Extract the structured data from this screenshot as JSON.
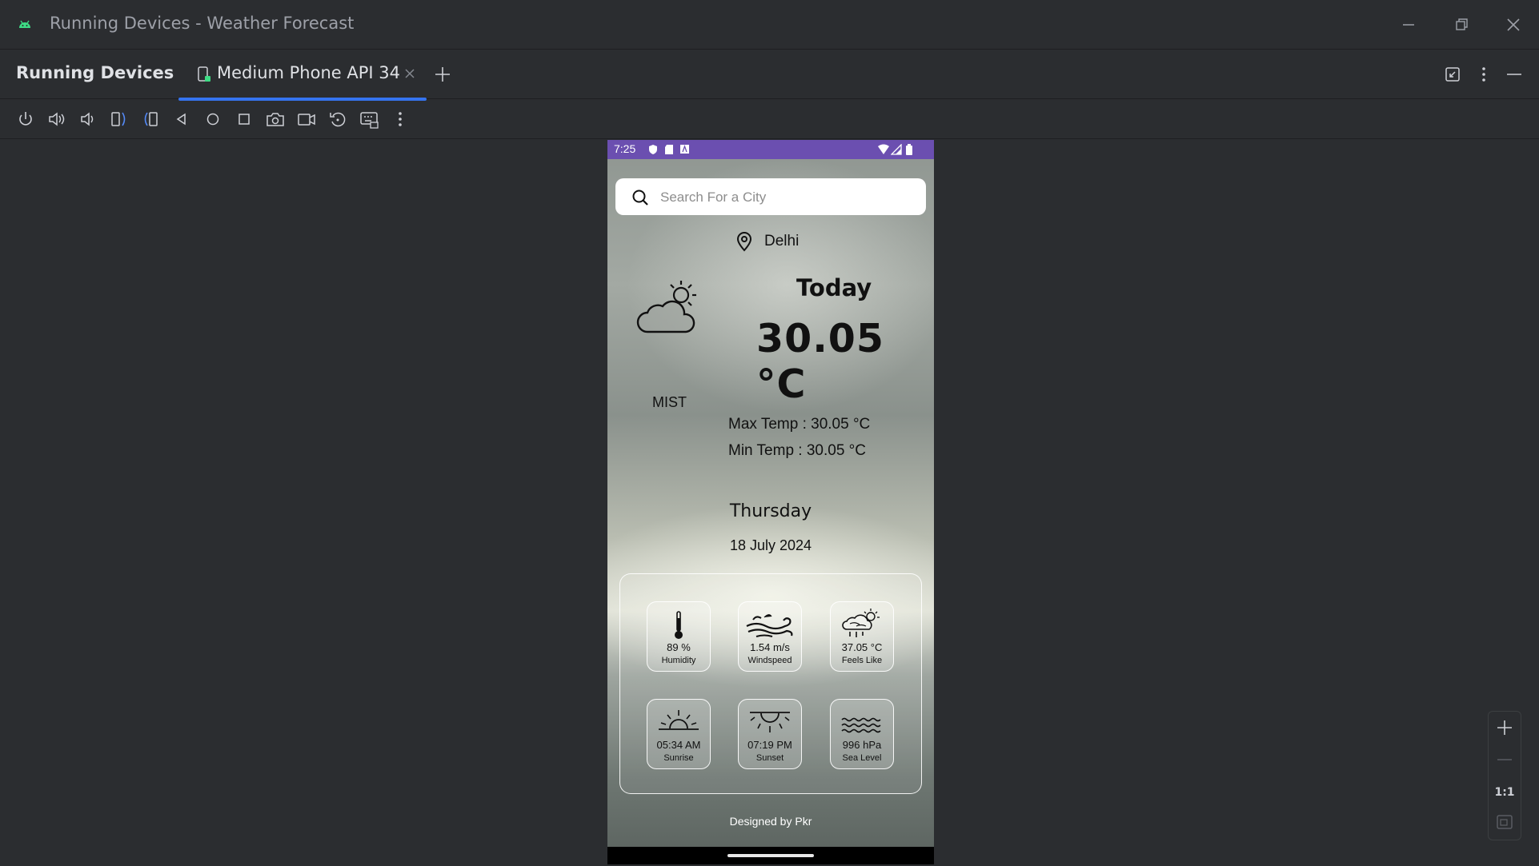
{
  "window": {
    "title": "Running Devices - Weather Forecast",
    "icons": [
      "android-icon",
      "minimize-icon",
      "restore-icon",
      "close-icon"
    ]
  },
  "panel": {
    "title": "Running Devices",
    "tab_label": "Medium Phone API 34",
    "active_tab_color": "#3574f0"
  },
  "toolbar": {
    "icons": [
      "power-icon",
      "volume-up-icon",
      "volume-down-icon",
      "rotate-left-icon",
      "rotate-right-icon",
      "back-icon",
      "home-icon",
      "overview-icon",
      "screenshot-icon",
      "screen-record-icon",
      "reset-icon",
      "keyboard-icon",
      "more-icon"
    ]
  },
  "phone": {
    "status": {
      "time": "7:25",
      "bar_color": "#6b4fb0"
    },
    "search": {
      "placeholder": "Search For a City",
      "value": ""
    },
    "location": "Delhi",
    "today_label": "Today",
    "temperature": "30.05 °C",
    "condition": "MIST",
    "max_temp": "Max Temp : 30.05 °C",
    "min_temp": "Min Temp : 30.05 °C",
    "day": "Thursday",
    "date": "18 July 2024",
    "details": [
      {
        "value": "89 %",
        "label": "Humidity",
        "icon": "thermometer-icon"
      },
      {
        "value": "1.54 m/s",
        "label": "Windspeed",
        "icon": "wind-icon"
      },
      {
        "value": "37.05 °C",
        "label": "Feels Like",
        "icon": "cloud-rain-sun-icon"
      },
      {
        "value": "05:34 AM",
        "label": "Sunrise",
        "icon": "sunrise-icon"
      },
      {
        "value": "07:19 PM",
        "label": "Sunset",
        "icon": "sunset-icon"
      },
      {
        "value": "996 hPa",
        "label": "Sea Level",
        "icon": "waves-icon"
      }
    ],
    "footer": "Designed by Pkr"
  },
  "zoom": {
    "reset_label": "1:1"
  }
}
